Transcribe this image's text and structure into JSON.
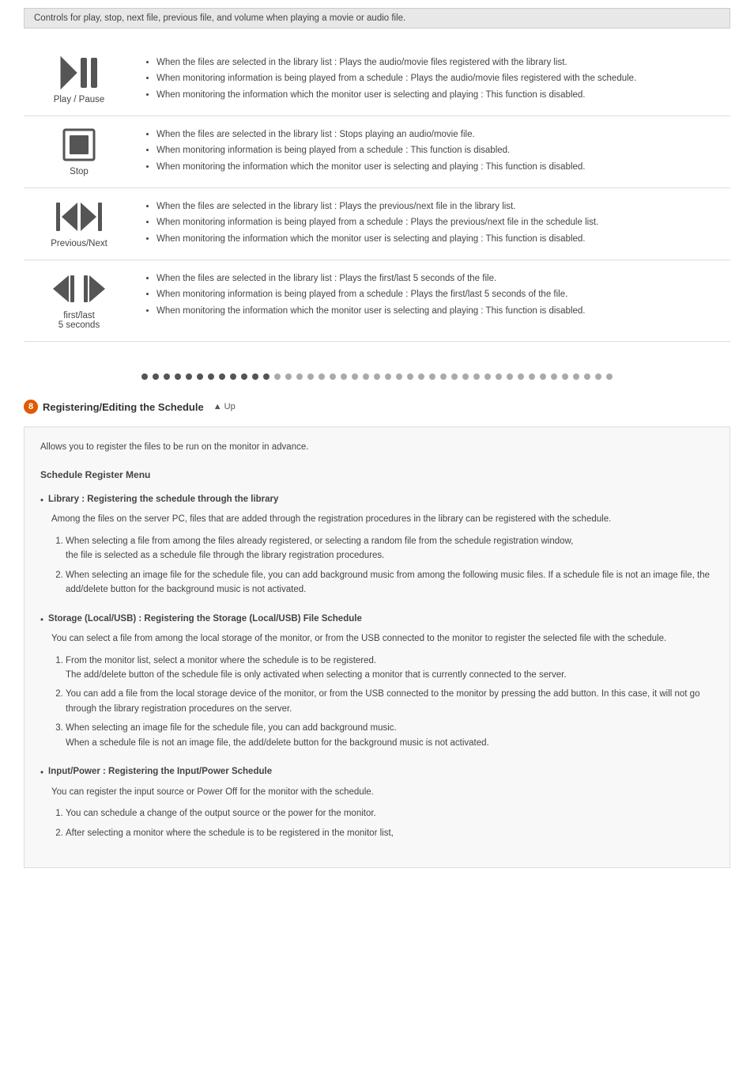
{
  "banner": {
    "text": "Controls for play, stop, next file, previous file, and volume when playing a movie or audio file."
  },
  "controls": [
    {
      "id": "play-pause",
      "label": "Play / Pause",
      "icon_type": "play-pause",
      "description": [
        "When the files are selected in the library list : Plays the audio/movie files registered with the library list.",
        "When monitoring information is being played from a schedule : Plays the audio/movie files registered with the schedule.",
        "When monitoring the information which the monitor user is selecting and playing : This function is disabled."
      ]
    },
    {
      "id": "stop",
      "label": "Stop",
      "icon_type": "stop",
      "description": [
        "When the files are selected in the library list : Stops playing an audio/movie file.",
        "When monitoring information is being played from a schedule : This function is disabled.",
        "When monitoring the information which the monitor user is selecting and playing : This function is disabled."
      ]
    },
    {
      "id": "previous-next",
      "label": "Previous/Next",
      "icon_type": "prev-next",
      "description": [
        "When the files are selected in the library list : Plays the previous/next file in the library list.",
        "When monitoring information is being played from a schedule : Plays the previous/next file in the schedule list.",
        "When monitoring the information which the monitor user is selecting and playing : This function is disabled."
      ]
    },
    {
      "id": "first-last",
      "label": "first/last\n5 seconds",
      "icon_type": "first-last",
      "description": [
        "When the files are selected in the library list : Plays the first/last 5 seconds of the file.",
        "When monitoring information is being played from a schedule : Plays the first/last 5 seconds of the file.",
        "When monitoring the information which the monitor user is selecting and playing : This function is disabled."
      ]
    }
  ],
  "dots": {
    "count": 43,
    "dark_indices": [
      0,
      1,
      2,
      3,
      4,
      5,
      6,
      7,
      8,
      9,
      10,
      11
    ]
  },
  "section8": {
    "number": "8",
    "title": "Registering/Editing the Schedule",
    "up_label": "▲ Up",
    "intro": "Allows you to register the files to be run on the monitor in advance.",
    "menu_title": "Schedule Register Menu",
    "menu_items": [
      {
        "id": "library",
        "header": "Library : Registering the schedule through the library",
        "desc": "Among the files on the server PC, files that are added through the registration procedures in the library can be registered with the schedule.",
        "items": [
          "When selecting a file from among the files already registered, or selecting a random file from the schedule registration window,\nthe file is selected as a schedule file through the library registration procedures.",
          "When selecting an image file for the schedule file, you can add background music from among the following music files. If a schedule file is not an image file, the add/delete button for the background music is not activated."
        ]
      },
      {
        "id": "storage",
        "header": "Storage (Local/USB) : Registering the Storage (Local/USB) File Schedule",
        "desc": "You can select a file from among the local storage of the monitor, or from the USB connected to the monitor to register the selected file with the schedule.",
        "items": [
          "From the monitor list, select a monitor where the schedule is to be registered.\nThe add/delete button of the schedule file is only activated when selecting a monitor that is currently connected to the server.",
          "You can add a file from the local storage device of the monitor, or from the USB connected to the monitor by pressing the add button. In this case, it will not go through the library registration procedures on the server.",
          "When selecting an image file for the schedule file, you can add background music.\nWhen a schedule file is not an image file, the add/delete button for the background music is not activated."
        ]
      },
      {
        "id": "input-power",
        "header": "Input/Power : Registering the Input/Power Schedule",
        "desc": "You can register the input source or Power Off for the monitor with the schedule.",
        "items": [
          "You can schedule a change of the output source or the power for the monitor.",
          "After selecting a monitor where the schedule is to be registered in the monitor list,"
        ]
      }
    ]
  }
}
